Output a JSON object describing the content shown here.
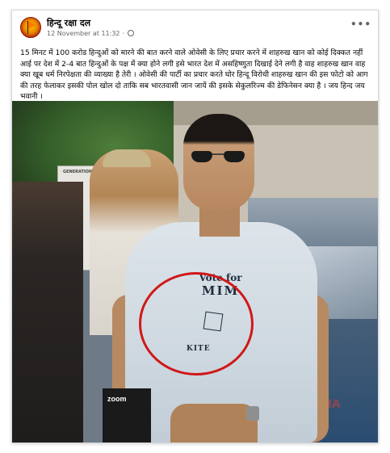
{
  "post": {
    "page_name": "हिन्दू रक्षा दल",
    "timestamp": "12 November at 11:32",
    "more_label": "•••",
    "text": "15 मिनट में 100 करोड हिन्दुओं को मारने की बात करने वाले ओवेसी के लिए प्रचार करने में शाहरुख खान को कोई दिक्कत नहीं आई पर देश में 2-4 बात हिन्दुओं के पक्ष में क्या होने लगी इसे भारत देश में असहिष्णुता दिखाई देने लगी है वाह शाहरुख खान वाह क्या खूब धर्म निरपेक्षता की व्याख्या है तेरी । ओवेसी की पार्टी का प्रचार करते घोर हिन्दू विरोधी शाहरुख खान की इस फोटो को आग की तरह फेलाकर इसकी पोल खोल दो ताकि सब भारतवासी जान जायें की इसके सेकुलरिज्म की डेफिनेसन क्या है । जय हिन्द जय भवानी ।"
  },
  "photo": {
    "van_text": "GENERATION VAN",
    "watermark": "TALHA",
    "shirt_line1": "Vote for",
    "shirt_line2": "MIM",
    "shirt_line3": "KITE",
    "mic_label": "zoom",
    "circle_color": "#d01818"
  },
  "icons": {
    "avatar": "saffron-flag-logo",
    "privacy": "globe-icon",
    "menu": "more-options-icon"
  }
}
